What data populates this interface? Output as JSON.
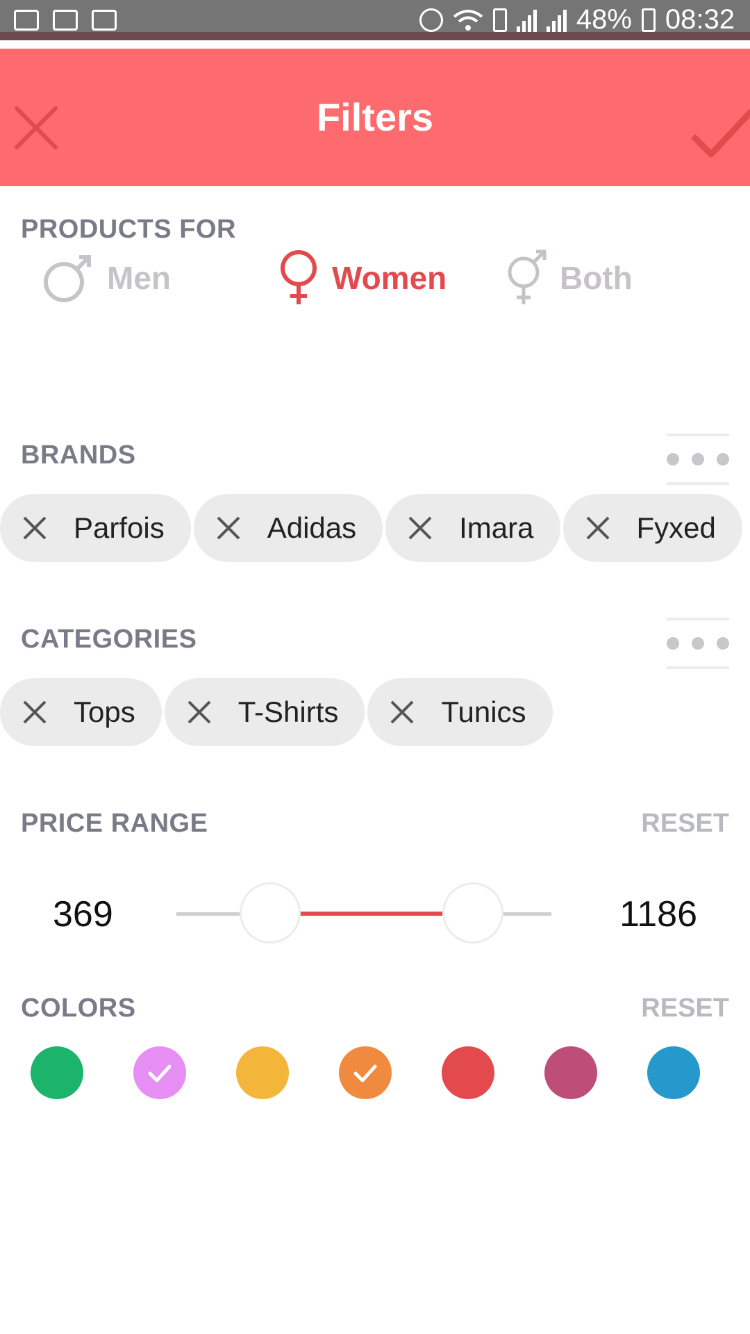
{
  "status_bar": {
    "battery": "48%",
    "time": "08:32",
    "left_icons": [
      "image-icon",
      "mail-icon",
      "sms-icon"
    ],
    "right_icons": [
      "alarm-icon",
      "wifi-icon",
      "sim-icon",
      "signal-icon",
      "signal-icon",
      "battery-icon"
    ]
  },
  "header": {
    "title": "Filters",
    "accent_color": "#fe6b6f",
    "close_icon": "close-icon",
    "apply_icon": "check-icon"
  },
  "products_for": {
    "title": "PRODUCTS FOR",
    "options": [
      {
        "label": "Men",
        "icon": "male-icon",
        "selected": false
      },
      {
        "label": "Women",
        "icon": "female-icon",
        "selected": true
      },
      {
        "label": "Both",
        "icon": "both-genders-icon",
        "selected": false
      }
    ]
  },
  "brands": {
    "title": "BRANDS",
    "more_icon": "more-dots-icon",
    "chips": [
      "Parfois",
      "Adidas",
      "Imara",
      "Fyxed"
    ]
  },
  "categories": {
    "title": "CATEGORIES",
    "more_icon": "more-dots-icon",
    "chips": [
      "Tops",
      "T-Shirts",
      "Tunics"
    ]
  },
  "price_range": {
    "title": "PRICE RANGE",
    "reset": "RESET",
    "min": "369",
    "max": "1186",
    "lower_handle_fraction": 0.25,
    "upper_handle_fraction": 0.79
  },
  "colors": {
    "title": "COLORS",
    "reset": "RESET",
    "swatches": [
      {
        "color": "#1cb46a",
        "selected": false
      },
      {
        "color": "#e78ef4",
        "selected": true
      },
      {
        "color": "#f4b63a",
        "selected": false
      },
      {
        "color": "#ef8a3e",
        "selected": true
      },
      {
        "color": "#e24a4e",
        "selected": false
      },
      {
        "color": "#be4d78",
        "selected": false
      },
      {
        "color": "#2699cc",
        "selected": false
      }
    ]
  }
}
